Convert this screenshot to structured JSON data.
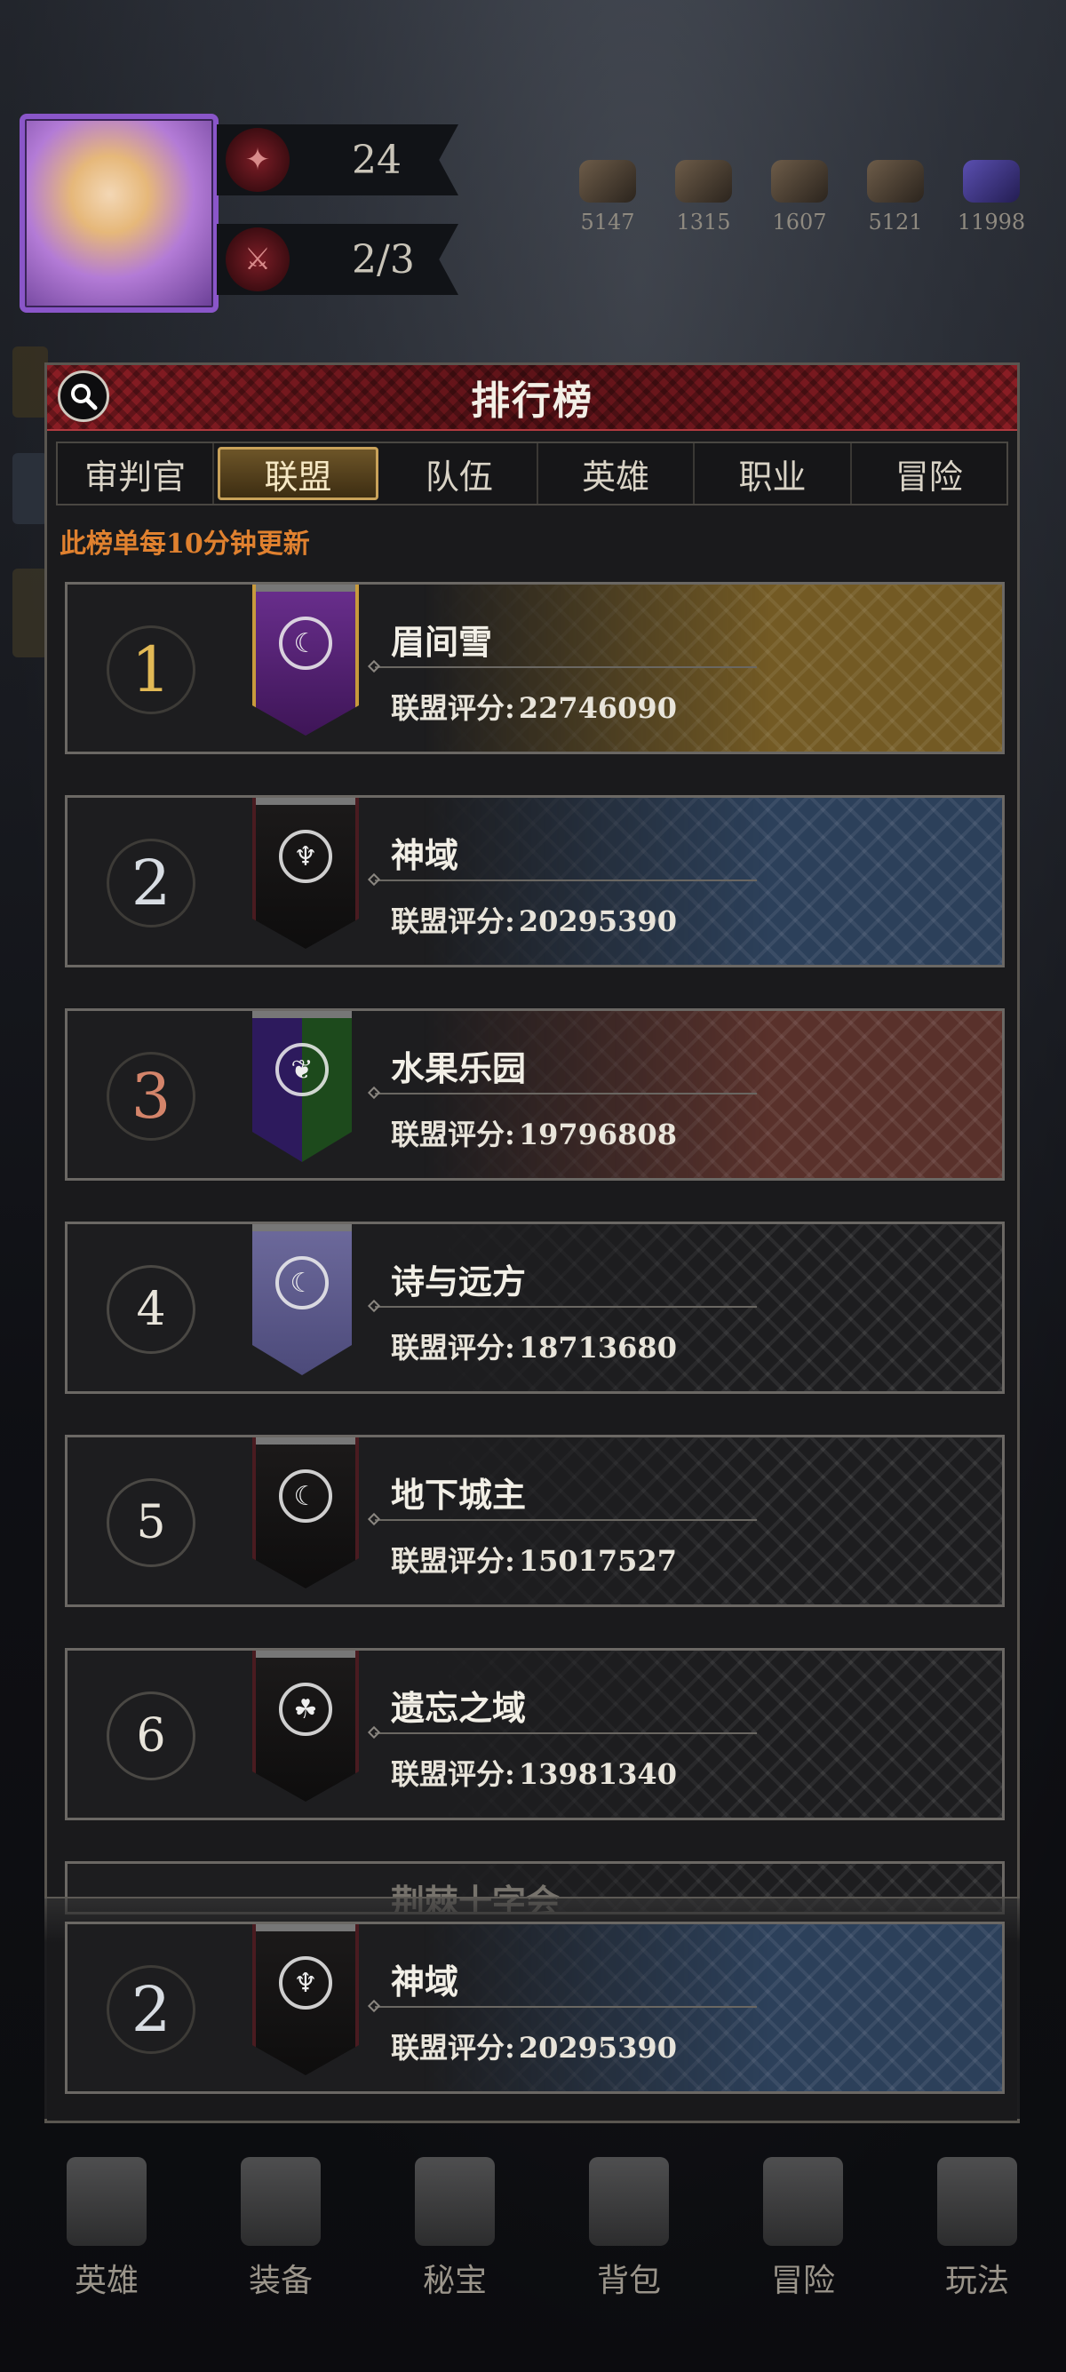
{
  "hud": {
    "level_value": "24",
    "stamina_value": "2/3",
    "resources": [
      "5147",
      "1315",
      "1607",
      "5121",
      "11998"
    ]
  },
  "modal": {
    "title": "排行榜",
    "tabs": [
      "审判官",
      "联盟",
      "队伍",
      "英雄",
      "职业",
      "冒险"
    ],
    "active_tab_index": 1,
    "refresh_note": "此榜单每10分钟更新",
    "score_label": "联盟评分:",
    "rows": [
      {
        "rank": "1",
        "name": "眉间雪",
        "score": "22746090"
      },
      {
        "rank": "2",
        "name": "神域",
        "score": "20295390"
      },
      {
        "rank": "3",
        "name": "水果乐园",
        "score": "19796808"
      },
      {
        "rank": "4",
        "name": "诗与远方",
        "score": "18713680"
      },
      {
        "rank": "5",
        "name": "地下城主",
        "score": "15017527"
      },
      {
        "rank": "6",
        "name": "遗忘之域",
        "score": "13981340"
      }
    ],
    "partial_row_name": "荆棘十字会",
    "my_alliance": {
      "rank": "2",
      "name": "神域",
      "score": "20295390"
    }
  },
  "bottom_nav": [
    "英雄",
    "装备",
    "秘宝",
    "背包",
    "冒险",
    "玩法"
  ],
  "colors": {
    "header_red": "#8b1d24",
    "tab_gold": "#c9a25a",
    "note_orange": "#e0812f"
  }
}
